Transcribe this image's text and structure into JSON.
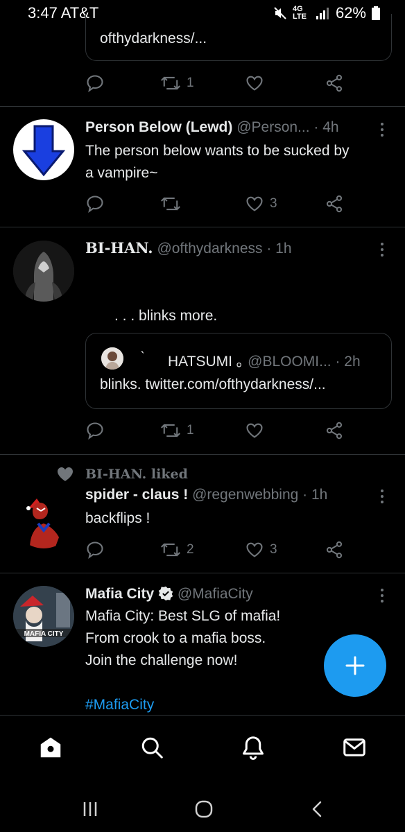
{
  "status_bar": {
    "time_carrier": "3:47 AT&T",
    "network": "4G LTE",
    "battery": "62%"
  },
  "tweets": [
    {
      "quote_text": "ofthydarkness/...",
      "reply_count": "",
      "retweet_count": "1",
      "like_count": ""
    },
    {
      "name": "Person Below (Lewd)",
      "handle": "@Person...",
      "time": "· 4h",
      "text_line1": "The person below wants to be sucked by",
      "text_line2": "a vampire~",
      "retweet_count": "",
      "like_count": "3"
    },
    {
      "name": "BI-HAN.",
      "handle": "@ofthydarkness",
      "time": "· 1h",
      "text": ". . . blinks more.",
      "quote": {
        "name": "HATSUMI ｡",
        "prefix": "˴",
        "handle": "@BLOOMI...",
        "time": "· 2h",
        "text": "blinks. twitter.com/ofthydarkness/..."
      },
      "retweet_count": "1",
      "like_count": ""
    },
    {
      "social_context": "BI-HAN. liked",
      "name": "spider - claus !",
      "handle": "@regenwebbing",
      "time": "· 1h",
      "text": "backflips !",
      "retweet_count": "2",
      "like_count": "3"
    },
    {
      "name": "Mafia City",
      "handle": "@MafiaCity",
      "text_line1": "Mafia City: Best SLG of mafia!",
      "text_line2": "From crook to a mafia boss.",
      "text_line3": "Join the challenge now!",
      "hashtag": "#MafiaCity",
      "avatar_text": "MAFIA CITY"
    }
  ],
  "icons": {
    "reply": "reply-icon",
    "retweet": "retweet-icon",
    "like": "heart-icon",
    "share": "share-icon",
    "more": "more-vertical-icon",
    "compose": "plus-icon"
  },
  "colors": {
    "background": "#000000",
    "accent": "#1d9bf0",
    "secondary_text": "#71767b",
    "divider": "#2f3336"
  }
}
